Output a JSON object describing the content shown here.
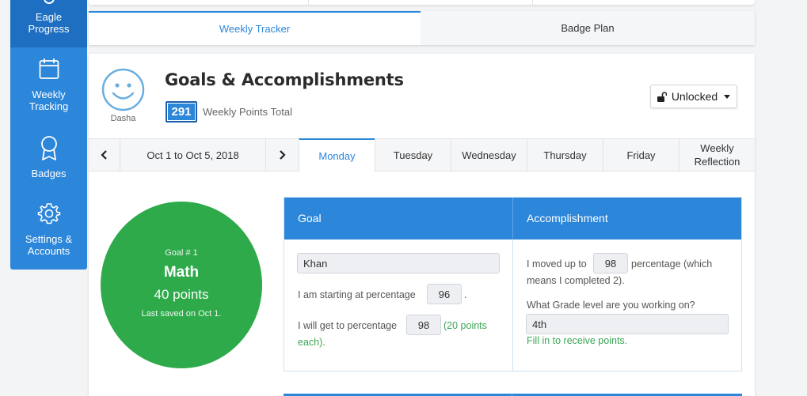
{
  "sidebar": {
    "items": [
      {
        "label": "Eagle Progress",
        "icon": "medal-icon"
      },
      {
        "label": "Weekly Tracking",
        "icon": "calendar-icon"
      },
      {
        "label": "Badges",
        "icon": "badge-icon"
      },
      {
        "label": "Settings & Accounts",
        "icon": "gear-icon"
      }
    ]
  },
  "tabs": [
    {
      "label": "Weekly Tracker"
    },
    {
      "label": "Badge Plan"
    }
  ],
  "profile": {
    "name": "Dasha",
    "avatar_icon": "smiley-icon"
  },
  "header": {
    "title": "Goals & Accomplishments",
    "points_total": "291",
    "points_label": "Weekly Points Total",
    "lock_label": "Unlocked"
  },
  "week_nav": {
    "range": "Oct 1 to Oct 5, 2018",
    "days": [
      "Monday",
      "Tuesday",
      "Wednesday",
      "Thursday",
      "Friday",
      "Weekly Reflection"
    ],
    "active_day": "Monday"
  },
  "goal_summary": {
    "number_label": "Goal # 1",
    "name": "Math",
    "points": "40 points",
    "saved": "Last saved on Oct 1."
  },
  "goal": {
    "header": "Goal",
    "program_value": "Khan",
    "start_text_before": "I am starting at percentage",
    "start_value": "96",
    "start_text_after": ".",
    "target_text_before": "I will get to percentage",
    "target_value": "98",
    "target_note_line1": "(20 points",
    "target_note_line2": "each)."
  },
  "accomplishment": {
    "header": "Accomplishment",
    "moved_text_before": "I moved up to",
    "moved_value": "98",
    "moved_text_after_line1": "percentage (which",
    "moved_text_after_line2": "means I completed 2).",
    "grade_question": "What Grade level are you working on?",
    "grade_value": "4th",
    "grade_hint": "Fill in to receive points."
  },
  "colors": {
    "primary": "#2c86d9",
    "goal_green": "#2eaa4a",
    "hint_green": "#3aa655"
  }
}
